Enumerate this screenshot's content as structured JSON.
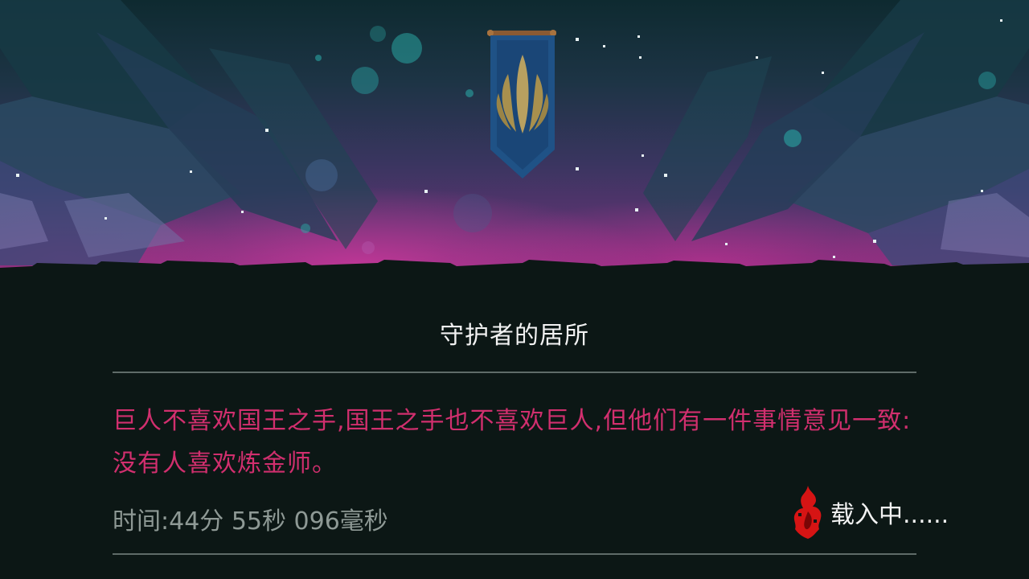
{
  "location": {
    "title": "守护者的居所"
  },
  "lore": {
    "text": "巨人不喜欢国王之手,国王之手也不喜欢巨人,但他们有一件事情意见一致:没有人喜欢炼金师。"
  },
  "run_timer": {
    "text": "时间:44分 55秒 096毫秒"
  },
  "loading": {
    "label": "载入中......",
    "icon": "flame-icon"
  },
  "banner": {
    "icon": "feather-crest-icon"
  },
  "colors": {
    "panel_bg": "#0c1715",
    "title": "#f2f2f2",
    "lore_text": "#d12f6e",
    "timer_text": "#8e9995",
    "divider": "#5f6b68",
    "banner_blue": "#1d4f84",
    "banner_gold": "#b59a52",
    "flame_red": "#d61414",
    "glow_magenta": "#d63aa0"
  }
}
